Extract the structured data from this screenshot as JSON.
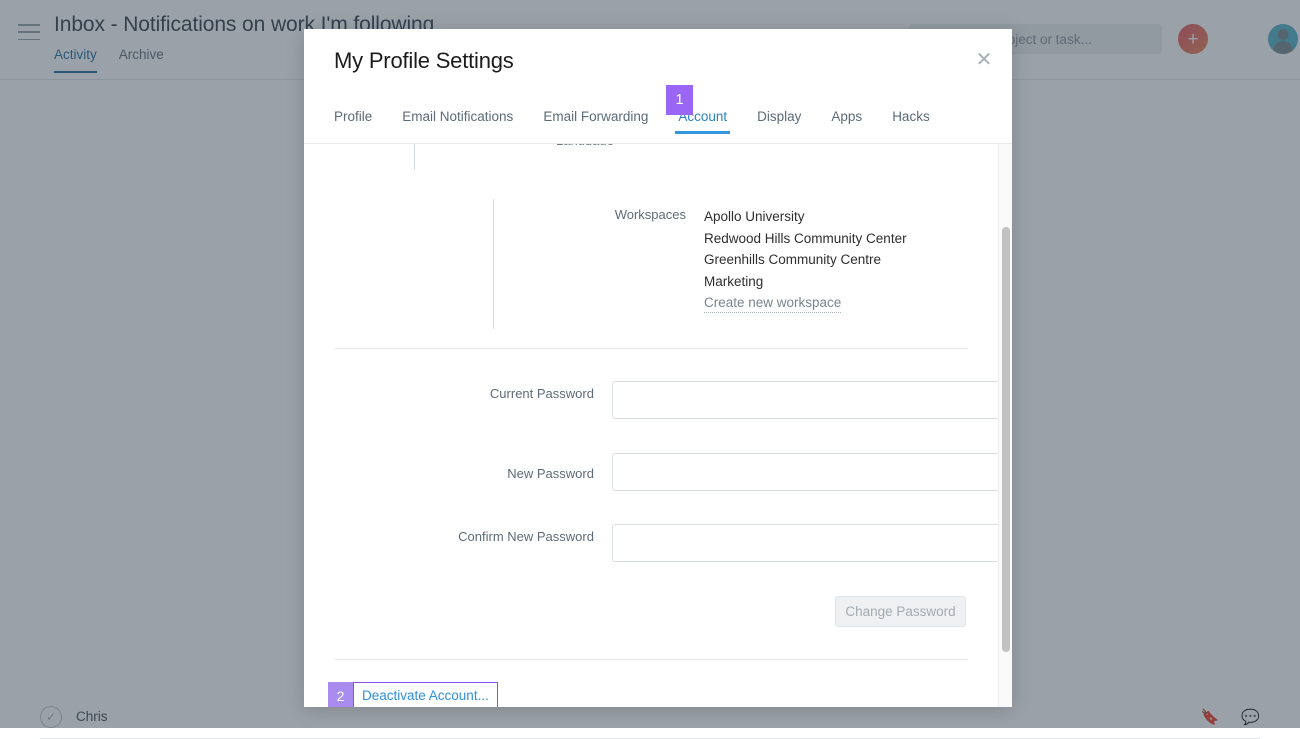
{
  "app": {
    "page_title": "Inbox - Notifications on work I'm following",
    "menu_icon": "hamburger-icon",
    "subtabs": [
      {
        "label": "Activity",
        "active": true
      },
      {
        "label": "Archive",
        "active": false
      }
    ],
    "search": {
      "icon": "search-icon",
      "placeholder": "Search a project or task..."
    },
    "add_button_label": "+",
    "avatar_label": "user-avatar",
    "background_row_text": "Chris"
  },
  "modal": {
    "title": "My Profile Settings",
    "close_icon": "✕",
    "tabs": [
      {
        "label": "Profile",
        "active": false
      },
      {
        "label": "Email Notifications",
        "active": false
      },
      {
        "label": "Email Forwarding",
        "active": false
      },
      {
        "label": "Account",
        "active": true
      },
      {
        "label": "Display",
        "active": false
      },
      {
        "label": "Apps",
        "active": false
      },
      {
        "label": "Hacks",
        "active": false
      }
    ],
    "workspaces": {
      "label": "Workspaces",
      "items": [
        "Apollo University",
        "Redwood Hills Community Center",
        "Greenhills Community Centre",
        "Marketing"
      ],
      "create_link": "Create new workspace"
    },
    "password": {
      "current_label": "Current Password",
      "current_value": "",
      "current_placeholder": "",
      "new_label": "New Password",
      "new_value": "",
      "new_placeholder": "",
      "confirm_label": "Confirm New Password",
      "confirm_value": "",
      "confirm_placeholder": "",
      "change_button": "Change Password"
    },
    "deactivate_link": "Deactivate Account..."
  },
  "annotations": [
    {
      "id": "1",
      "target": "account-tab",
      "color": "#9966f5"
    },
    {
      "id": "2",
      "target": "deactivate-account-link",
      "color": "#a98bf0"
    }
  ],
  "colors": {
    "accent_blue": "#3596e0",
    "link_blue": "#2d8fe0",
    "annotation_purple": "#9966f5",
    "annotation_border": "#8b4ff0",
    "overlay": "rgba(40,56,70,0.47)"
  }
}
